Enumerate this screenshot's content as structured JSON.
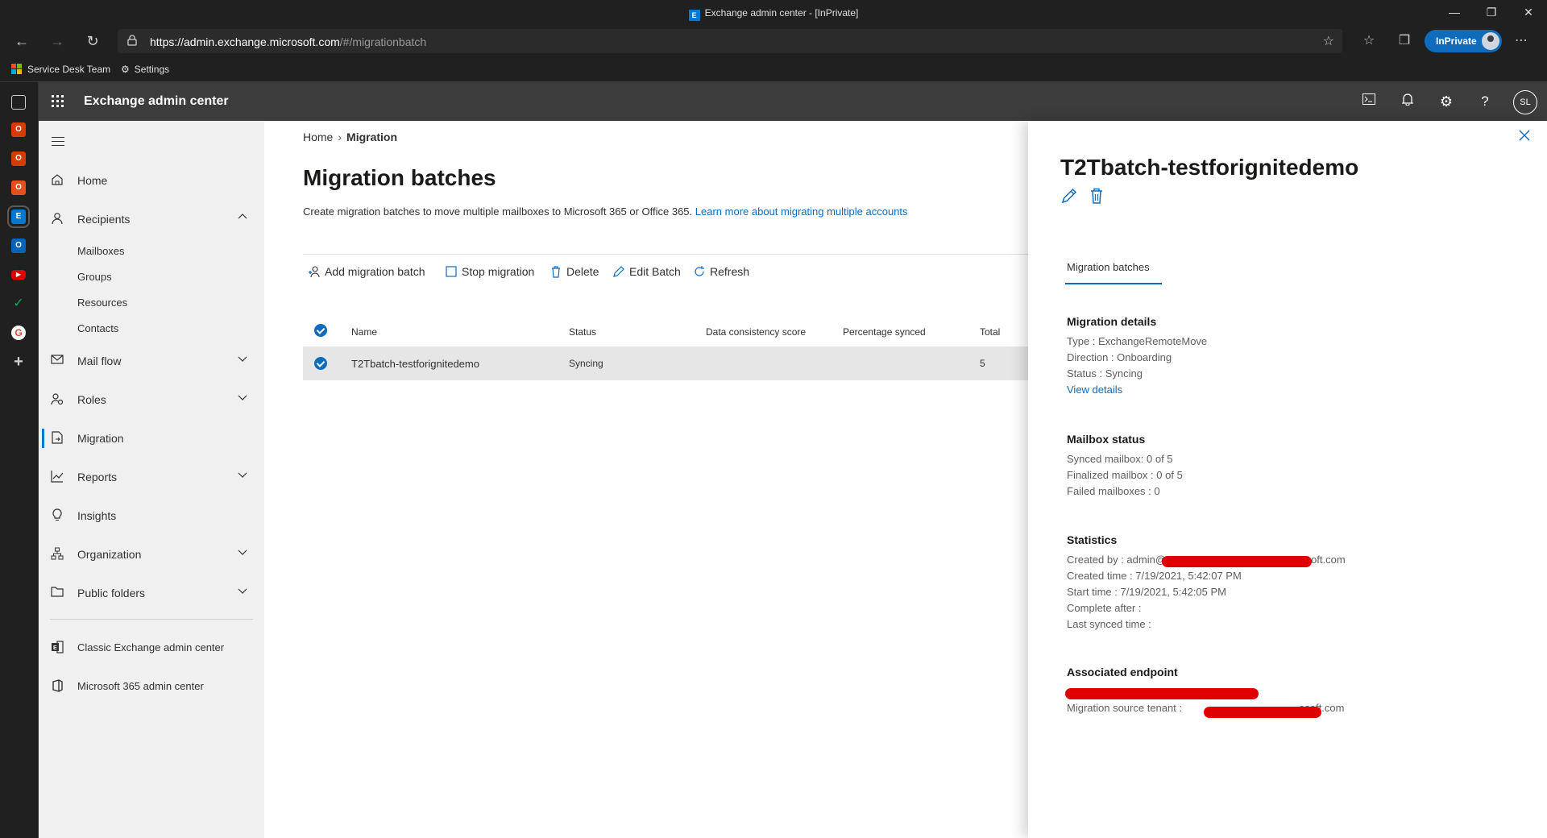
{
  "browser": {
    "window_title": "Exchange admin center - [InPrivate]",
    "tab_icon_letter": "E",
    "url_base": "https://admin.exchange.microsoft.com",
    "url_path": "/#/migrationbatch",
    "inprivate_label": "InPrivate",
    "favorites": [
      "Service Desk Team",
      "Settings"
    ]
  },
  "suite": {
    "app_name": "Exchange admin center",
    "user_initials": "SL"
  },
  "nav": {
    "items": [
      {
        "label": "Home",
        "icon": "home-icon"
      },
      {
        "label": "Recipients",
        "icon": "person-icon",
        "expanded": true
      },
      {
        "label": "Mail flow",
        "icon": "mail-icon"
      },
      {
        "label": "Roles",
        "icon": "roles-icon"
      },
      {
        "label": "Migration",
        "icon": "migration-icon",
        "active": true
      },
      {
        "label": "Reports",
        "icon": "chart-icon"
      },
      {
        "label": "Insights",
        "icon": "lightbulb-icon"
      },
      {
        "label": "Organization",
        "icon": "org-icon"
      },
      {
        "label": "Public folders",
        "icon": "folder-icon"
      }
    ],
    "recipients_sub": [
      "Mailboxes",
      "Groups",
      "Resources",
      "Contacts"
    ],
    "links": [
      "Classic Exchange admin center",
      "Microsoft 365 admin center"
    ]
  },
  "main": {
    "breadcrumb": [
      "Home",
      "Migration"
    ],
    "title": "Migration batches",
    "description": "Create migration batches to move multiple mailboxes to Microsoft 365 or Office 365.",
    "learn_more": "Learn more about migrating multiple accounts",
    "commands": [
      "Add migration batch",
      "Stop migration",
      "Delete",
      "Edit Batch",
      "Refresh"
    ],
    "columns": [
      "Name",
      "Status",
      "Data consistency score",
      "Percentage synced",
      "Total"
    ],
    "rows": [
      {
        "name": "T2Tbatch-testforignitedemo",
        "status": "Syncing",
        "data_consistency": "",
        "percentage": "",
        "total": "5"
      }
    ]
  },
  "panel": {
    "title": "T2Tbatch-testforignitedemo",
    "tab": "Migration batches",
    "details": {
      "heading": "Migration details",
      "type": "Type : ExchangeRemoteMove",
      "direction": "Direction : Onboarding",
      "status": "Status : Syncing",
      "link": "View details"
    },
    "mailbox": {
      "heading": "Mailbox status",
      "synced": "Synced mailbox: 0 of 5",
      "finalized": "Finalized mailbox : 0 of 5",
      "failed": "Failed mailboxes : 0"
    },
    "stats": {
      "heading": "Statistics",
      "created_by_prefix": "Created by : admin@",
      "created_by_suffix": "oft.com",
      "created_time": "Created time : 7/19/2021, 5:42:07 PM",
      "start_time": "Start time : 7/19/2021, 5:42:05 PM",
      "complete_after": "Complete after :",
      "last_synced": "Last synced time :"
    },
    "endpoint": {
      "heading": "Associated endpoint",
      "source_prefix": "Migration source tenant :",
      "source_suffix": "osoft.com"
    }
  },
  "colors": {
    "accent": "#0f6cbd",
    "header_bg": "#3c3c3c",
    "nav_bg": "#f0f0f0",
    "redaction": "#e00000"
  }
}
